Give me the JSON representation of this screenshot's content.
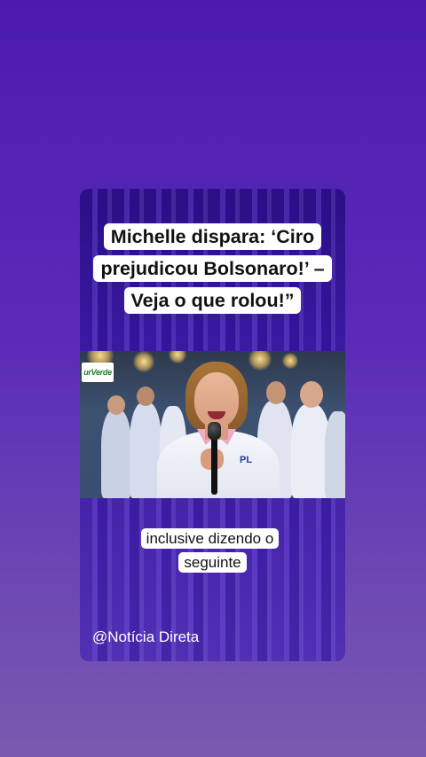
{
  "post": {
    "headline": "Michelle dispara: ‘Ciro prejudicou Bolsonaro!’ – Veja o que rolou!”",
    "caption": "inclusive dizendo o seguinte",
    "handle": "@Notícia Direta",
    "photo": {
      "logo_text": "urVerde"
    }
  },
  "colors": {
    "background_top": "#4b1bb0",
    "background_bottom": "#7a5aae",
    "card": "#3b1aa3",
    "label_bg": "#ffffff"
  }
}
